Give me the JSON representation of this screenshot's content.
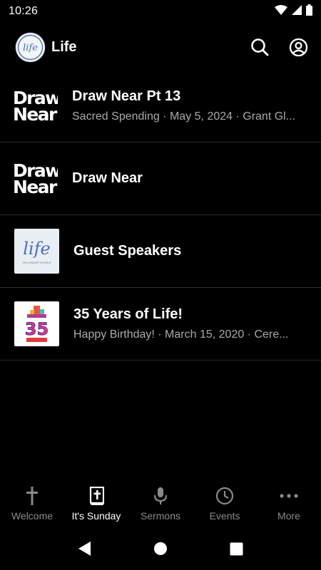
{
  "status_bar": {
    "time": "10:26"
  },
  "app_bar": {
    "title": "Life",
    "logo_text": "life"
  },
  "items": [
    {
      "thumb_line1": "Draw",
      "thumb_line2": "Near",
      "title": "Draw Near Pt 13",
      "subtitle": "Sacred Spending · May 5, 2024 · Grant Gl..."
    },
    {
      "thumb_line1": "Draw",
      "thumb_line2": "Near",
      "title": "Draw Near",
      "subtitle": ""
    },
    {
      "thumb_logo_text": "life",
      "thumb_caption": "FELLOWSHIP CHURCH",
      "title": "Guest Speakers",
      "subtitle": ""
    },
    {
      "thumb_number": "35",
      "title": "35 Years of Life!",
      "subtitle": "Happy Birthday! · March 15, 2020 · Cere..."
    }
  ],
  "nav": [
    {
      "label": "Welcome",
      "icon": "cross-icon"
    },
    {
      "label": "It's Sunday",
      "icon": "bible-icon"
    },
    {
      "label": "Sermons",
      "icon": "microphone-icon"
    },
    {
      "label": "Events",
      "icon": "clock-icon"
    },
    {
      "label": "More",
      "icon": "more-icon"
    }
  ],
  "colors": {
    "background": "#000000",
    "active_nav": "#ffffff",
    "inactive_nav": "#8a8a8a",
    "subtitle": "#a9a9a9",
    "logo_blue": "#4a72b8"
  }
}
